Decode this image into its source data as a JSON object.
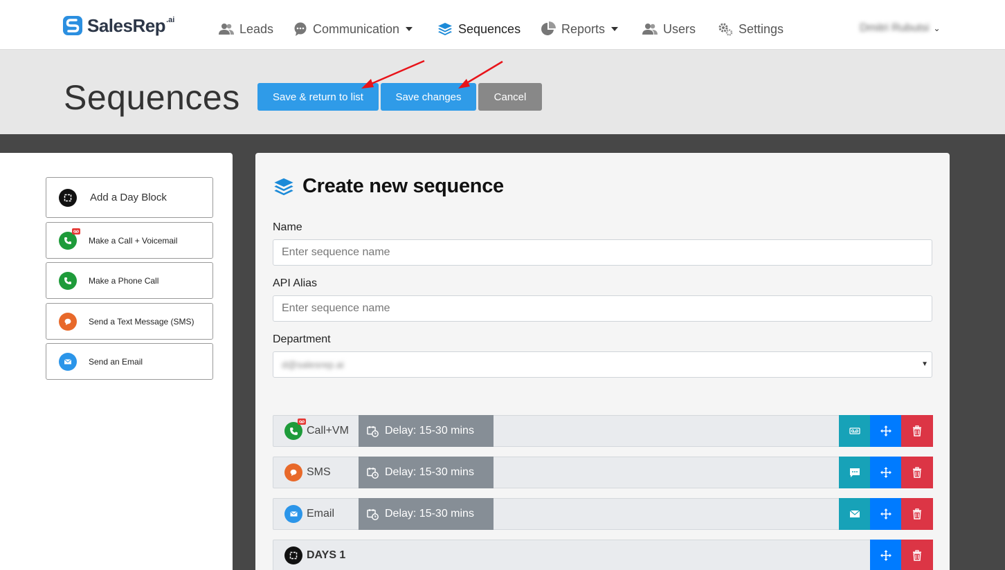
{
  "brand": {
    "name": "SalesRep",
    "suffix": ".ai"
  },
  "nav": {
    "items": [
      {
        "label": "Leads",
        "icon": "users-icon"
      },
      {
        "label": "Communication",
        "icon": "chat-icon",
        "dropdown": true
      },
      {
        "label": "Sequences",
        "icon": "layers-icon",
        "active": true
      },
      {
        "label": "Reports",
        "icon": "pie-chart-icon",
        "dropdown": true
      },
      {
        "label": "Users",
        "icon": "users-icon"
      },
      {
        "label": "Settings",
        "icon": "gears-icon"
      }
    ],
    "user_name": "Dmitri Rubutsi"
  },
  "header": {
    "title": "Sequences",
    "save_return_label": "Save & return to list",
    "save_changes_label": "Save changes",
    "cancel_label": "Cancel"
  },
  "toolbox": {
    "items": [
      {
        "label": "Add a Day Block",
        "icon": "day-block-icon"
      },
      {
        "label": "Make a Call + Voicemail",
        "icon": "phone-voicemail-icon"
      },
      {
        "label": "Make a Phone Call",
        "icon": "phone-icon"
      },
      {
        "label": "Send a Text Message (SMS)",
        "icon": "sms-icon"
      },
      {
        "label": "Send an Email",
        "icon": "email-icon"
      }
    ]
  },
  "form": {
    "heading": "Create new sequence",
    "name_label": "Name",
    "name_placeholder": "Enter sequence name",
    "alias_label": "API Alias",
    "alias_placeholder": "Enter sequence name",
    "department_label": "Department",
    "department_value": "d@salesrep.ai"
  },
  "steps": [
    {
      "name": "Call+VM",
      "delay": "Delay: 15-30 mins",
      "icon": "phone-voicemail-icon",
      "action_icon": "voicemail-icon"
    },
    {
      "name": "SMS",
      "delay": "Delay: 15-30 mins",
      "icon": "sms-icon",
      "action_icon": "message-icon"
    },
    {
      "name": "Email",
      "delay": "Delay: 15-30 mins",
      "icon": "email-icon",
      "action_icon": "envelope-icon"
    },
    {
      "name": "DAYS 1",
      "icon": "day-block-icon"
    }
  ],
  "colors": {
    "primary": "#2f9be8",
    "green": "#1e9b3a",
    "orange": "#e8692a",
    "blue_icon": "#2b95e9",
    "teal": "#17a2b8",
    "blue_action": "#007bff",
    "red": "#dc3545",
    "annotation_arrow": "#e8141a"
  }
}
